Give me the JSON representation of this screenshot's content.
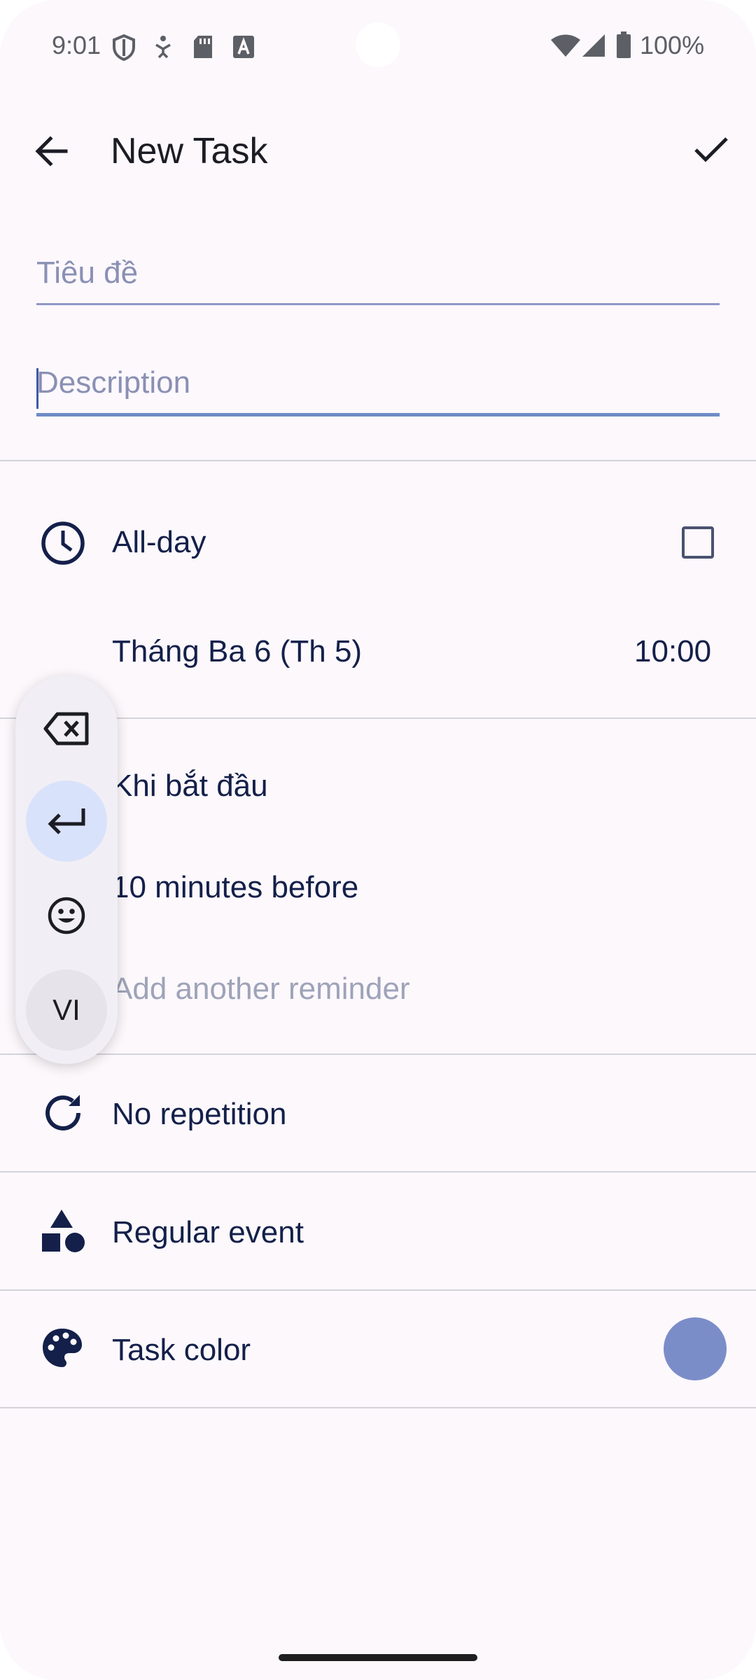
{
  "status_bar": {
    "time": "9:01",
    "battery": "100%",
    "icons": [
      "shield-icon",
      "accessibility-icon",
      "sd-card-icon",
      "font-a-icon",
      "wifi-icon",
      "cell-signal-icon",
      "battery-icon"
    ]
  },
  "top_bar": {
    "title": "New Task",
    "back_icon": "arrow-back-icon",
    "save_icon": "check-icon"
  },
  "form": {
    "title_placeholder": "Tiêu đề",
    "description_placeholder": "Description"
  },
  "all_day": {
    "label": "All-day",
    "checked": false
  },
  "date_time": {
    "date": "Tháng Ba 6 (Th 5)",
    "time": "10:00"
  },
  "reminders": {
    "items": [
      "Khi bắt đầu",
      "10 minutes before"
    ],
    "add_label": "Add another reminder"
  },
  "repetition": {
    "label": "No repetition"
  },
  "event_type": {
    "label": "Regular event"
  },
  "task_color": {
    "label": "Task color",
    "color": "#7b8dc9"
  },
  "keyboard_toolbar": {
    "buttons": [
      "backspace-icon",
      "enter-icon",
      "emoji-icon"
    ],
    "language": "VI"
  }
}
